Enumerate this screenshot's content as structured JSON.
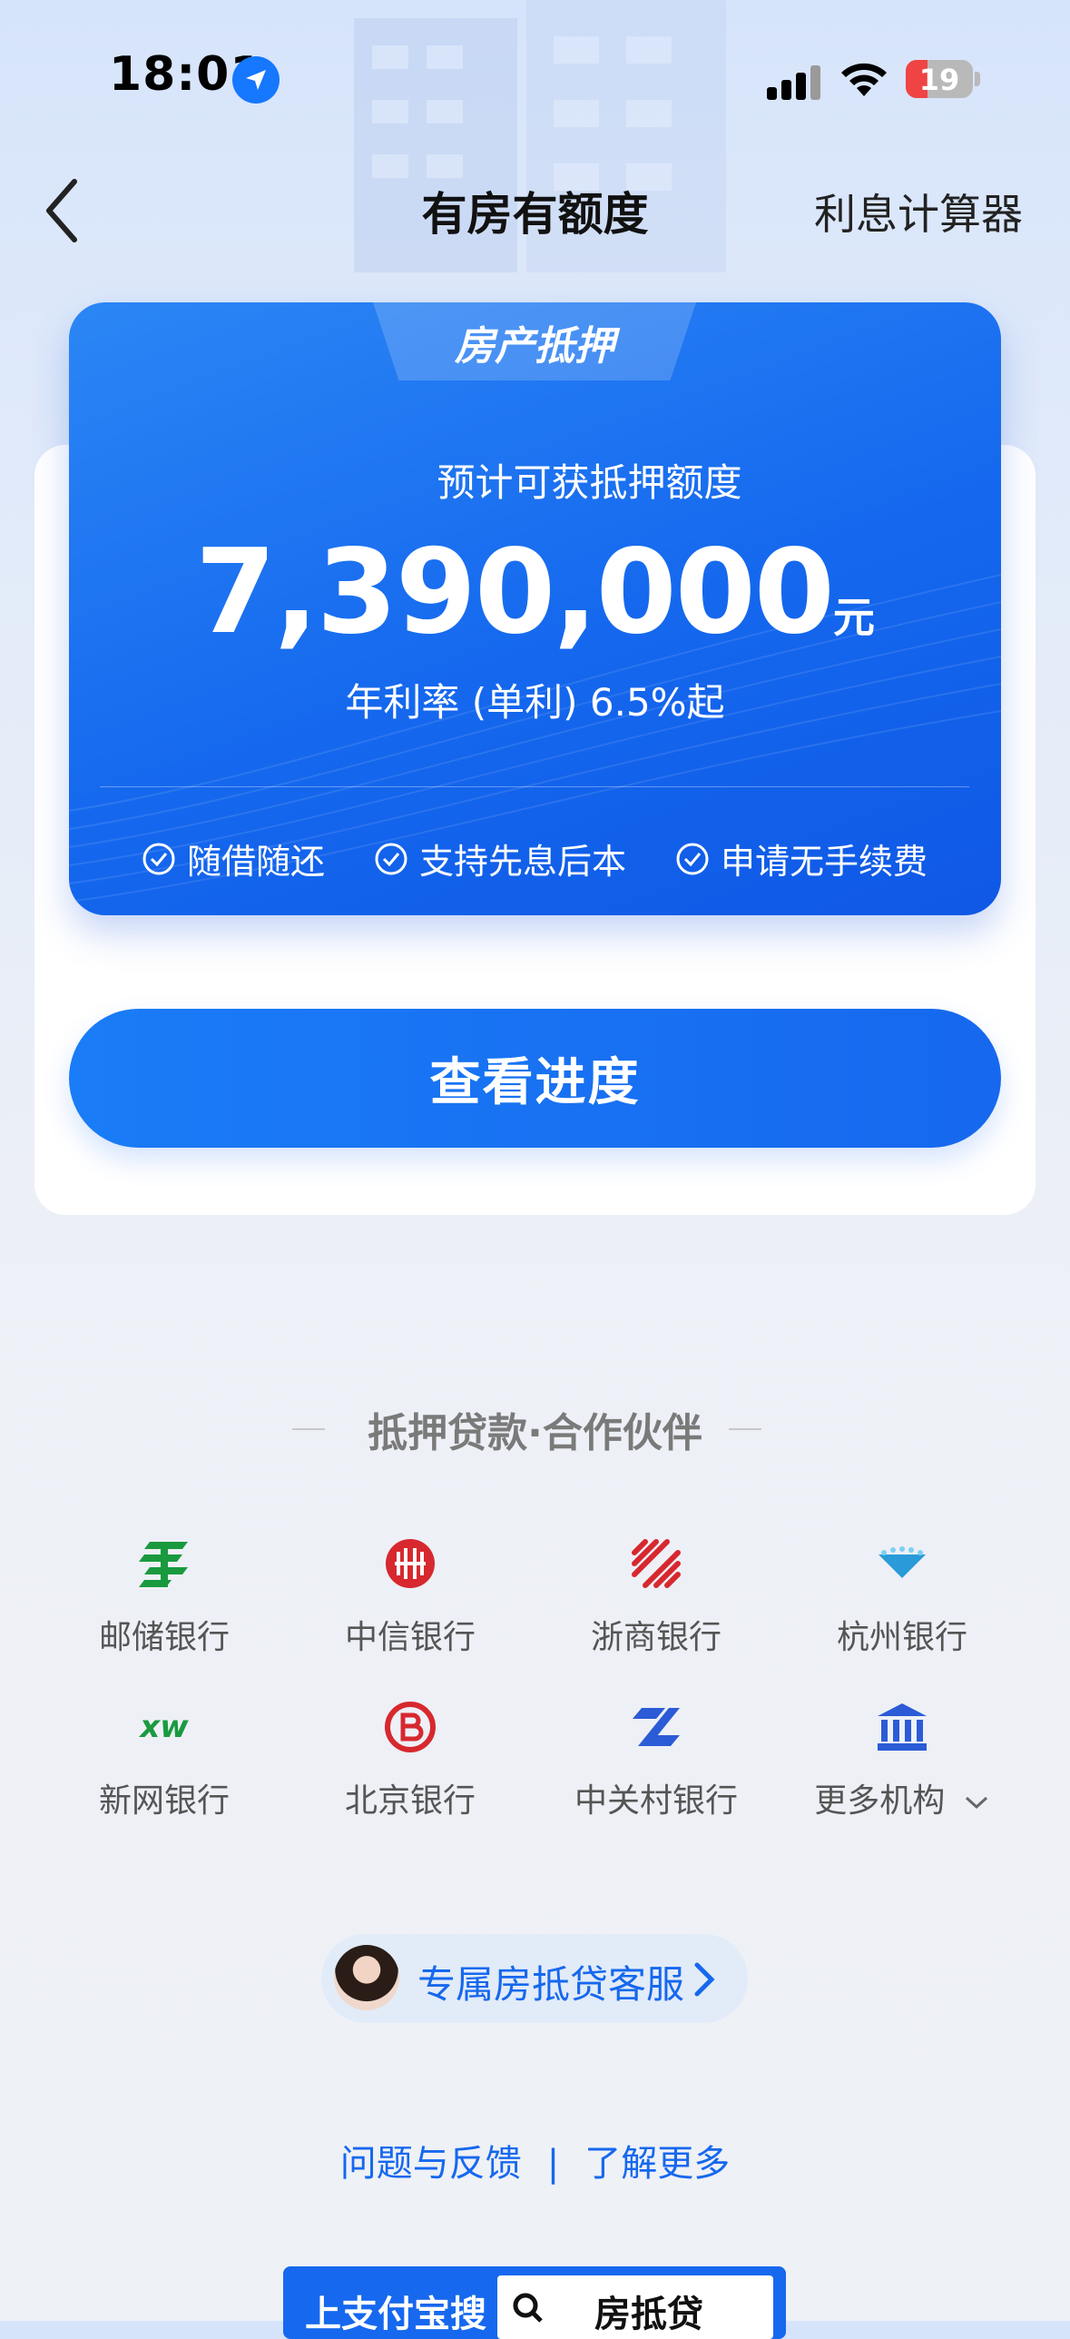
{
  "status": {
    "time": "18:01",
    "battery": "19"
  },
  "nav": {
    "title": "有房有额度",
    "calculator": "利息计算器"
  },
  "card": {
    "tab": "房产抵押",
    "label": "预计可获抵押额度",
    "amount": "7,390,000",
    "unit": "元",
    "rate": "年利率 (单利) 6.5%起",
    "features": [
      "随借随还",
      "支持先息后本",
      "申请无手续费"
    ]
  },
  "button": {
    "label": "查看进度"
  },
  "partners": {
    "title": "抵押贷款·合作伙伴",
    "banks": [
      {
        "name": "邮储银行",
        "icon": "psbc-logo-icon",
        "color": "#1a9a3f"
      },
      {
        "name": "中信银行",
        "icon": "citic-logo-icon",
        "color": "#d7282f"
      },
      {
        "name": "浙商银行",
        "icon": "czbank-logo-icon",
        "color": "#d7282f"
      },
      {
        "name": "杭州银行",
        "icon": "hzbank-logo-icon",
        "color": "#2a9bd8"
      },
      {
        "name": "新网银行",
        "icon": "xw-logo-icon",
        "color": "#1a9a3f",
        "text": "xw"
      },
      {
        "name": "北京银行",
        "icon": "bob-logo-icon",
        "color": "#d7282f"
      },
      {
        "name": "中关村银行",
        "icon": "zgc-logo-icon",
        "color": "#2b5bd6"
      },
      {
        "name": "更多机构",
        "icon": "bank-building-icon",
        "color": "#2b5bd6"
      }
    ]
  },
  "service": {
    "label": "专属房抵贷客服"
  },
  "links": {
    "feedback": "问题与反馈",
    "sep": "|",
    "more": "了解更多"
  },
  "banner": {
    "prefix": "上支付宝搜",
    "query": "房抵贷"
  }
}
